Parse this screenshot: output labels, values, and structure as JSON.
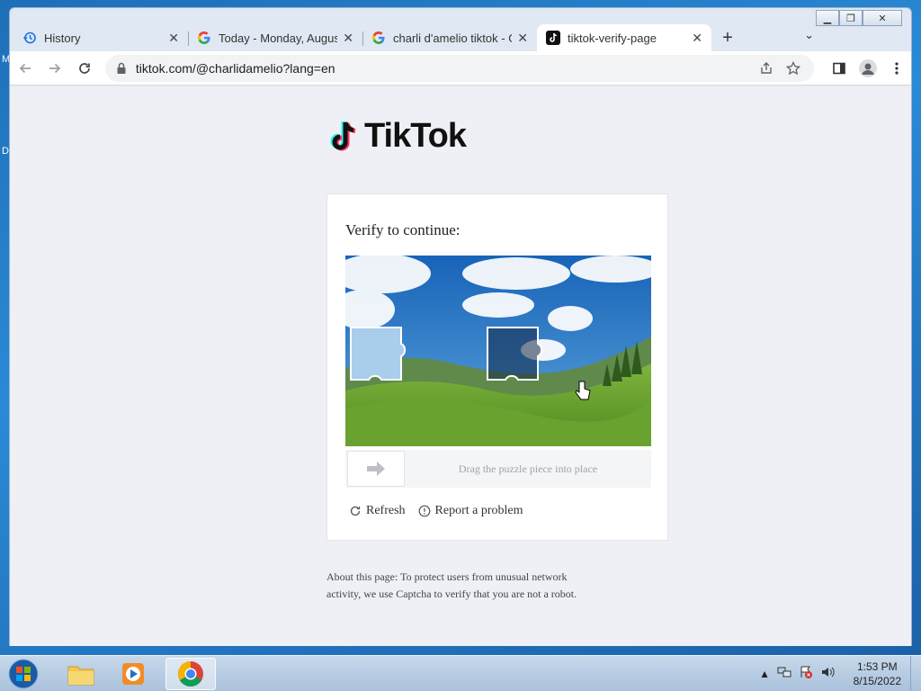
{
  "desktop": {
    "stub_top": "M",
    "stub_mid": "D"
  },
  "window": {
    "minimize": "▁",
    "restore": "❐",
    "close": "✕"
  },
  "tabs": [
    {
      "title": "History",
      "icon": "history-icon",
      "active": false
    },
    {
      "title": "Today - Monday, August",
      "icon": "google-icon",
      "active": false
    },
    {
      "title": "charli d'amelio tiktok - G",
      "icon": "google-icon",
      "active": false
    },
    {
      "title": "tiktok-verify-page",
      "icon": "tiktok-icon",
      "active": true
    }
  ],
  "tab_close": "✕",
  "new_tab": "+",
  "tab_search": "⌄",
  "address": {
    "url": "tiktok.com/@charlidamelio?lang=en"
  },
  "page": {
    "logo_text": "TikTok",
    "card_title": "Verify to continue:",
    "slider_text": "Drag the puzzle piece into place",
    "refresh_label": "Refresh",
    "report_label": "Report a problem",
    "about_text": "About this page: To protect users from unusual network activity, we use Captcha to verify that you are not a robot."
  },
  "taskbar": {
    "apps": [
      "explorer-icon",
      "media-player-icon",
      "chrome-icon"
    ],
    "tray_up": "▲",
    "time": "1:53 PM",
    "date": "8/15/2022"
  },
  "colors": {
    "tiktok_cyan": "#25f4ee",
    "tiktok_red": "#fe2c55",
    "chrome_tab_active": "#ffffff"
  }
}
